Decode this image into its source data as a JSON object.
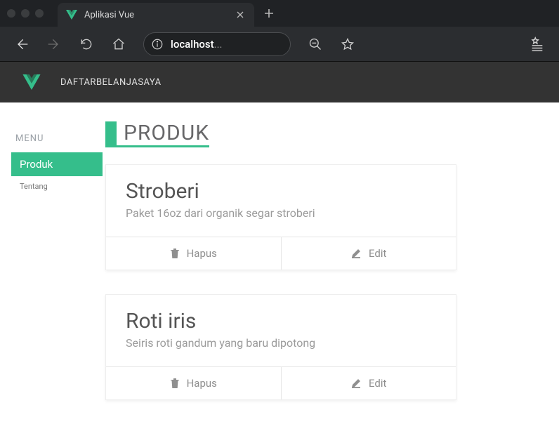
{
  "browser": {
    "tab_title": "Aplikasi Vue",
    "url_host": "localhost",
    "url_rest": "..."
  },
  "header": {
    "brand": "DAFTARBELANJASAYA"
  },
  "sidebar": {
    "heading": "MENU",
    "items": [
      {
        "label": "Produk",
        "active": true
      },
      {
        "label": "Tentang",
        "active": false
      }
    ]
  },
  "page": {
    "title": "PRODUK"
  },
  "products": [
    {
      "name": "Stroberi",
      "description": "Paket 16oz dari organik segar stroberi"
    },
    {
      "name": "Roti iris",
      "description": "Seiris roti gandum yang baru dipotong"
    }
  ],
  "actions": {
    "delete_label": "Hapus",
    "edit_label": "Edit"
  }
}
